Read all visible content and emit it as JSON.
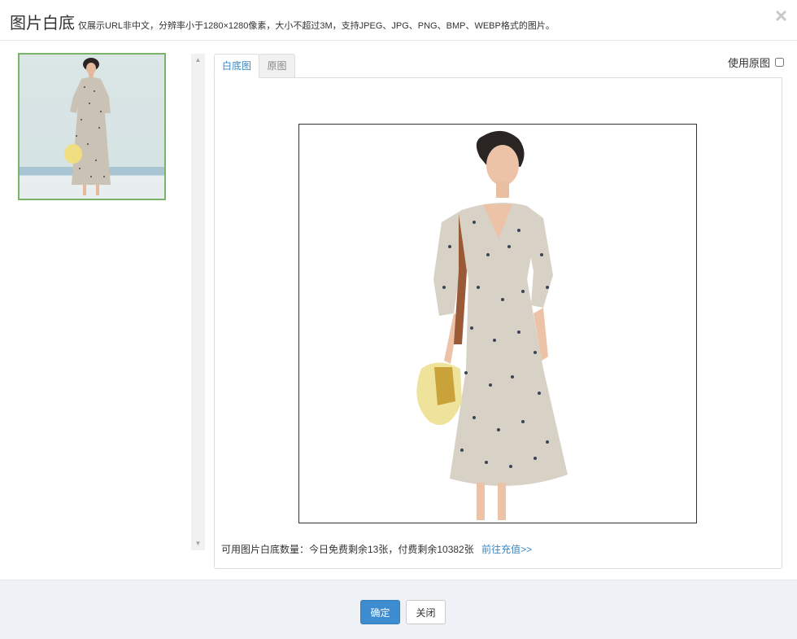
{
  "header": {
    "title": "图片白底",
    "hint": "仅展示URL非中文，分辨率小于1280×1280像素，大小不超过3M，支持JPEG、JPG、PNG、BMP、WEBP格式的图片。",
    "close_glyph": "×"
  },
  "sidebar": {
    "thumbnail_selected": true,
    "scroll_up_glyph": "▲",
    "scroll_down_glyph": "▼"
  },
  "tabs": [
    {
      "label": "白底图",
      "active": true
    },
    {
      "label": "原图",
      "active": false
    }
  ],
  "use_original": {
    "label": "使用原图",
    "checked": false
  },
  "quota": {
    "text": "可用图片白底数量：今日免费剩余13张，付费剩余10382张",
    "link": "前往充值>>"
  },
  "footer": {
    "confirm_label": "确定",
    "close_label": "关闭"
  },
  "colors": {
    "accent": "#3a87c4",
    "primary_button": "#3e8cd0",
    "thumbnail_border": "#7bb36a",
    "footer_bg": "#eef1f5"
  }
}
